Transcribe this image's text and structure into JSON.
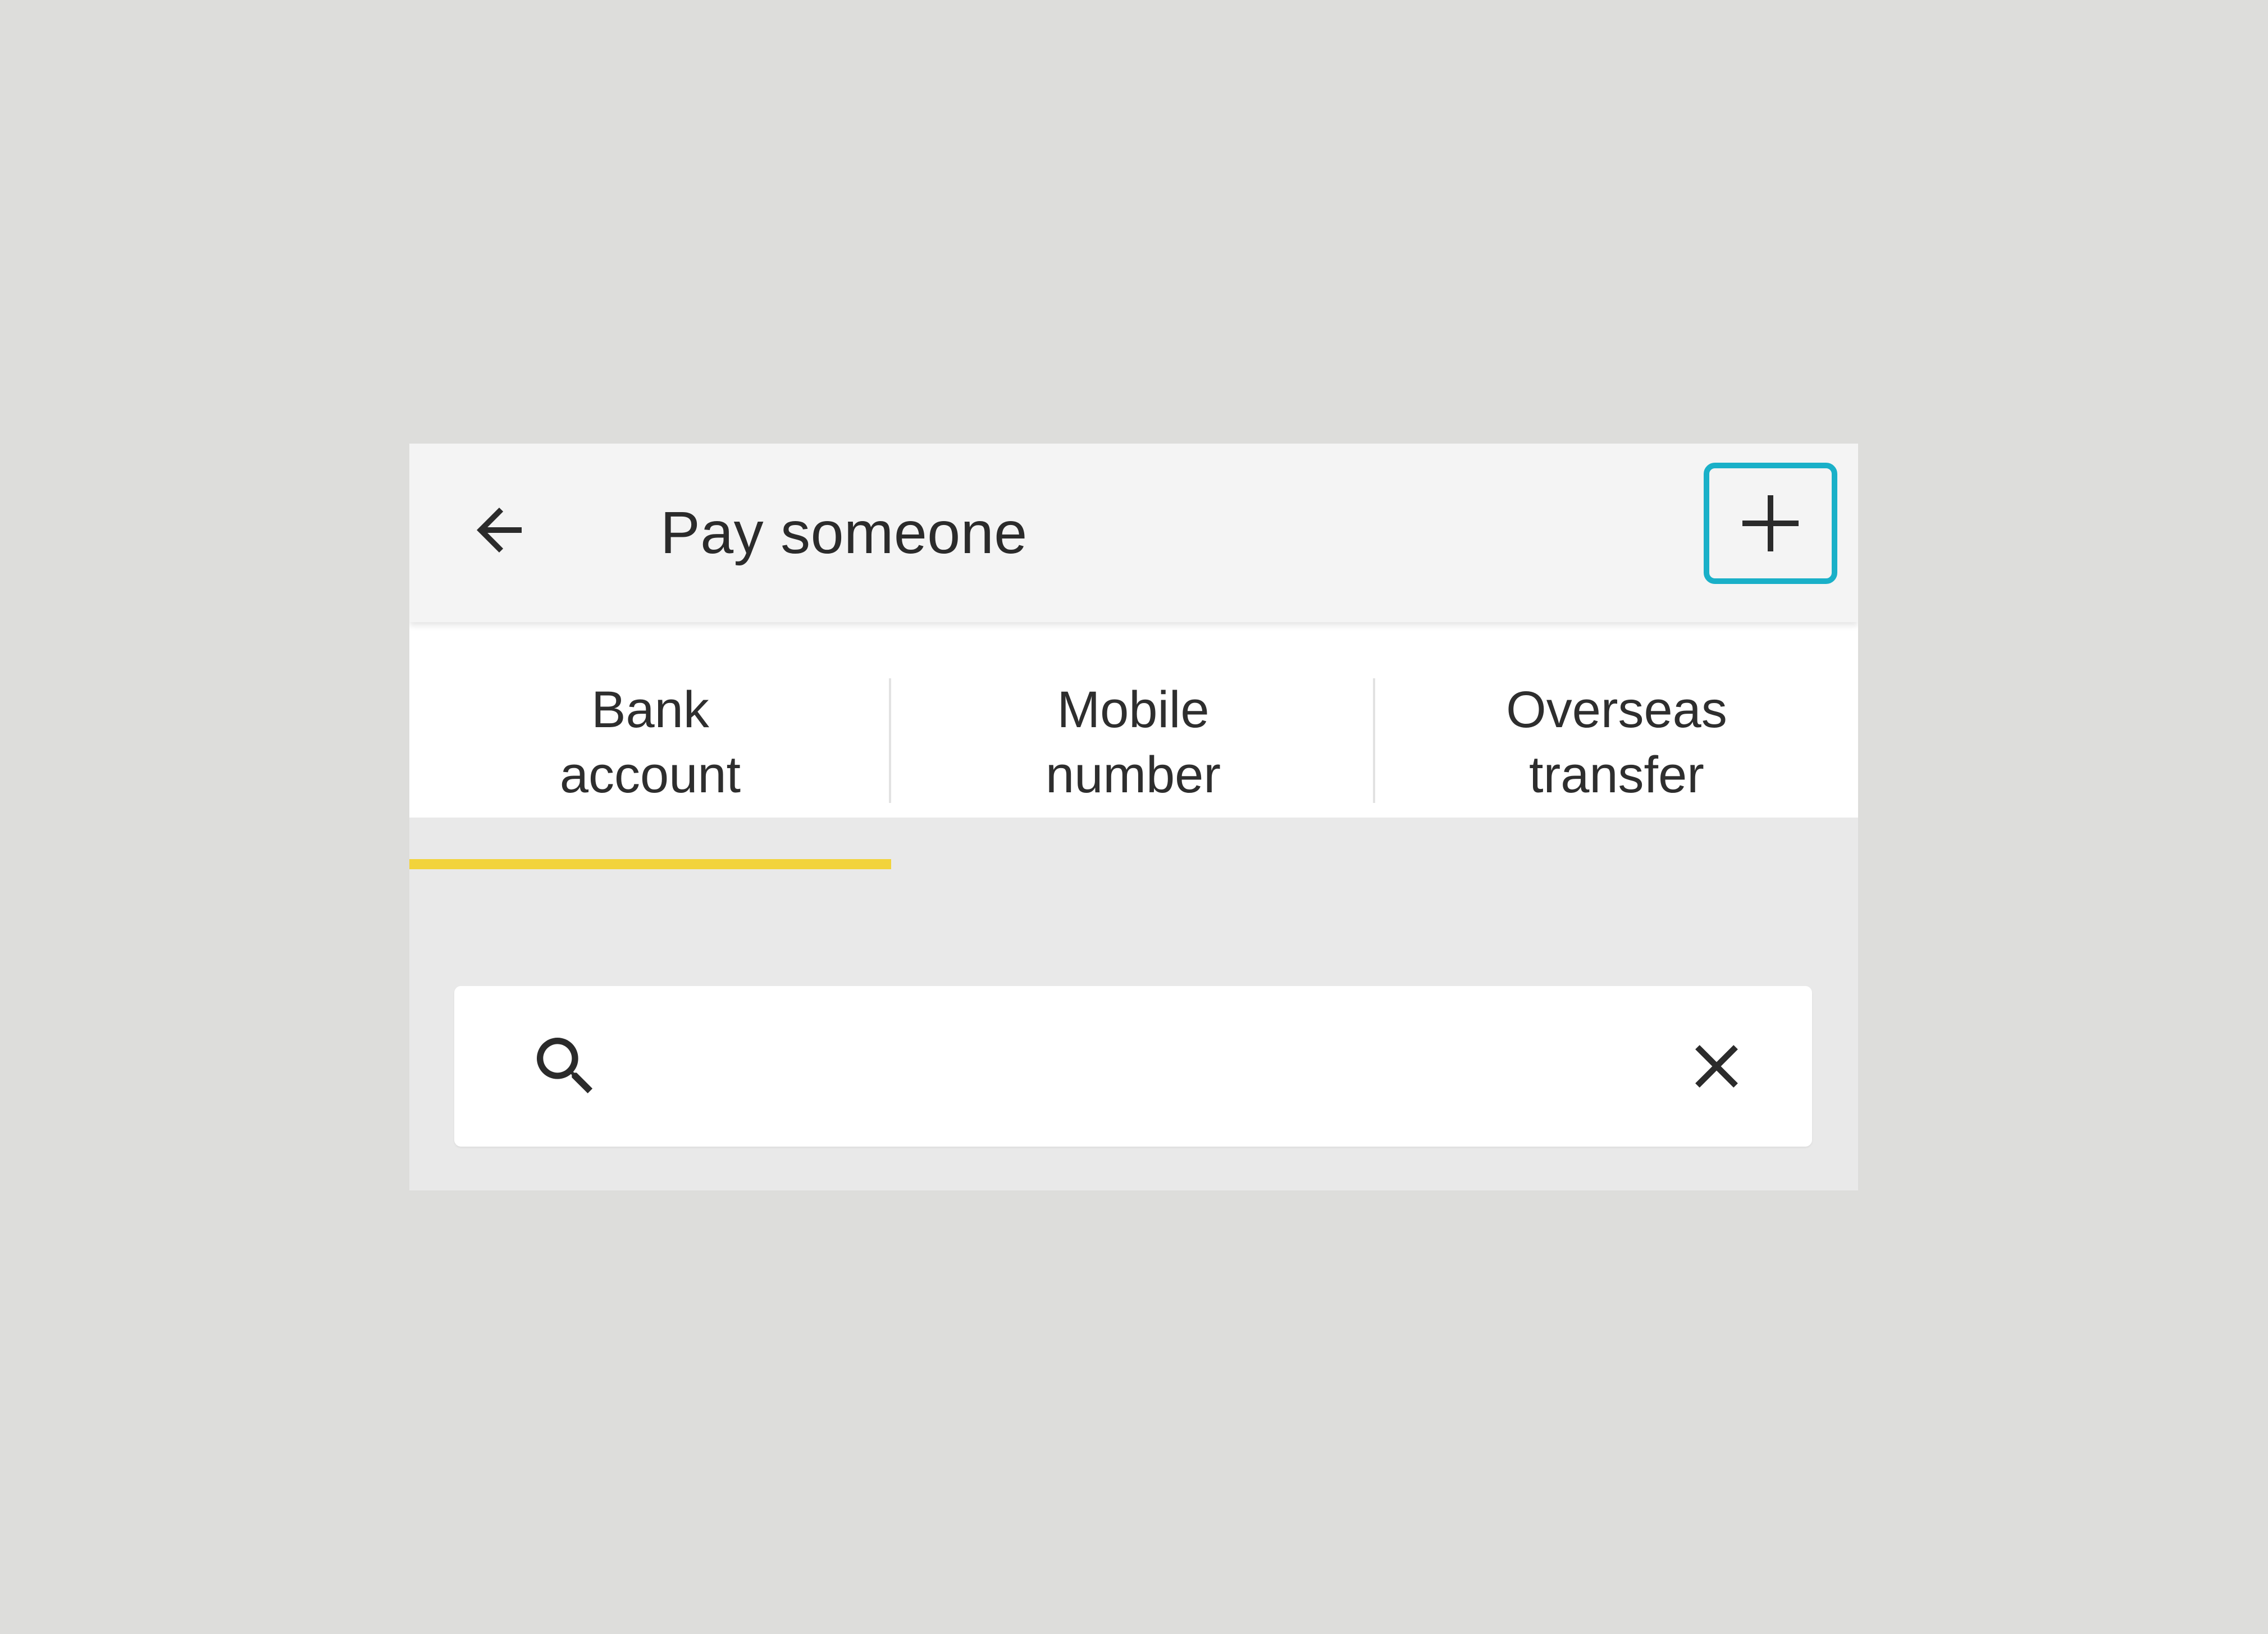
{
  "header": {
    "title": "Pay someone",
    "back_icon": "arrow-left-icon",
    "add_icon": "plus-icon",
    "highlight_color": "#1ab0c8"
  },
  "tabs": [
    {
      "label": "Bank\naccount",
      "active": true
    },
    {
      "label": "Mobile\nnumber",
      "active": false
    },
    {
      "label": "Overseas\ntransfer",
      "active": false
    }
  ],
  "active_tab_color": "#f2d33b",
  "search": {
    "value": "",
    "placeholder": "",
    "search_icon": "search-icon",
    "clear_icon": "close-icon"
  }
}
